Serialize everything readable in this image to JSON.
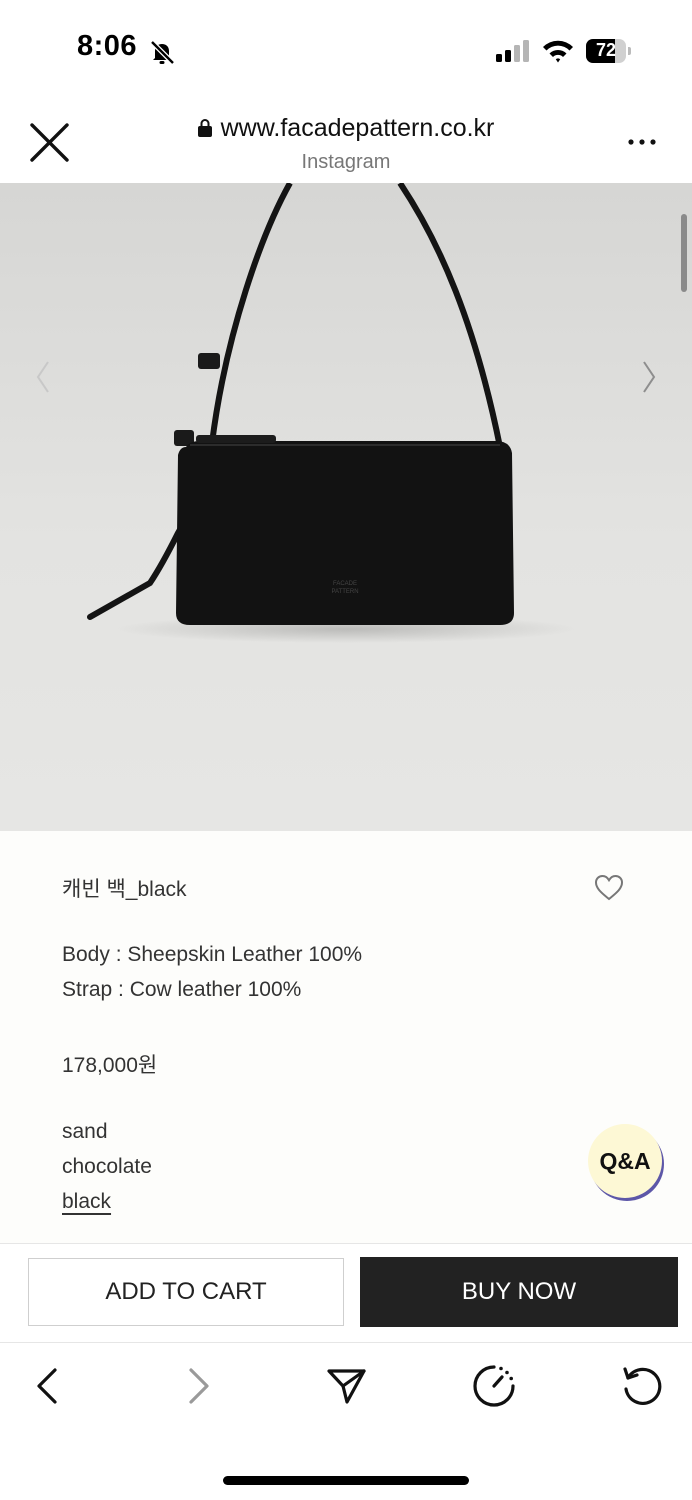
{
  "status_bar": {
    "time": "8:06",
    "battery_level": "72",
    "battery_fraction": 0.72
  },
  "browser": {
    "url": "www.facadepattern.co.kr",
    "source": "Instagram"
  },
  "product": {
    "name": "캐빈 백_black",
    "material_body": "Body : Sheepskin Leather 100%",
    "material_strap": "Strap : Cow leather 100%",
    "price": "178,000원",
    "colors": [
      "sand",
      "chocolate",
      "black"
    ],
    "selected_color": "black"
  },
  "floating": {
    "qa_label": "Q&A"
  },
  "actions": {
    "add_to_cart": "ADD TO CART",
    "buy_now": "BUY NOW"
  },
  "colors": {
    "accent_dark": "#222222",
    "qa_bg": "#fdf8d5",
    "qa_shadow": "#5d57a8",
    "info_bg": "#fdfdfb"
  }
}
